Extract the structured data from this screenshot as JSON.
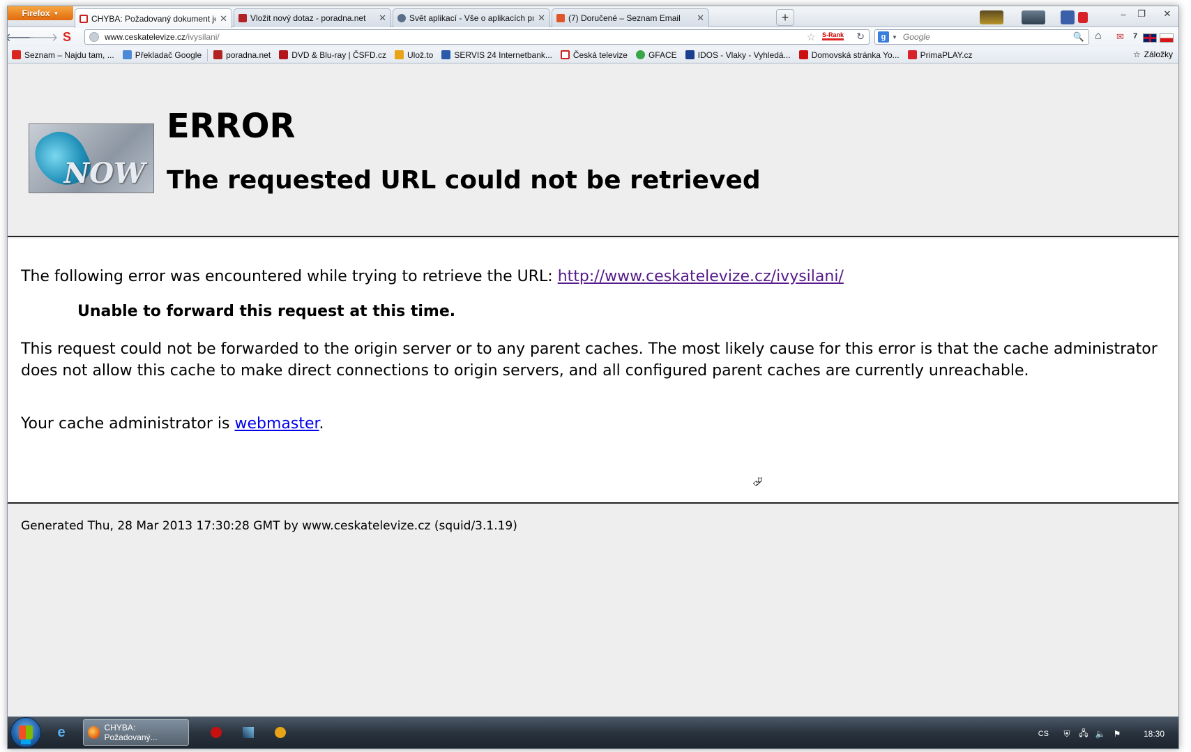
{
  "browser": {
    "menu_button": "Firefox",
    "tabs": [
      {
        "label": "CHYBA: Požadovaný dokument je ne...",
        "icon_color": "#cc1f1f",
        "active": true
      },
      {
        "label": "Vložit nový dotaz - poradna.net",
        "icon_color": "#b22222",
        "active": false
      },
      {
        "label": "Svět aplikací - Vše o aplikacích pro ch...",
        "icon_color": "#5a6f8a",
        "active": false
      },
      {
        "label": "(7) Doručené – Seznam Email",
        "icon_color": "#e0552a",
        "active": false
      }
    ],
    "url": {
      "host": "www.ceskatelevize.cz",
      "path": "/ivysilani/"
    },
    "srank_label": "S-Rank",
    "search_placeholder": "Google",
    "mail_count": "7",
    "bookmarks": [
      {
        "label": "Seznam – Najdu tam, ...",
        "icon_color": "#d9251d"
      },
      {
        "label": "Překladač Google",
        "icon_color": "#4a8ad6"
      },
      {
        "label": "poradna.net",
        "icon_color": "#b22222"
      },
      {
        "label": "DVD & Blu-ray | ČSFD.cz",
        "icon_color": "#b4151a"
      },
      {
        "label": "Ulož.to",
        "icon_color": "#e8a317"
      },
      {
        "label": "SERVIS 24 Internetbank...",
        "icon_color": "#2a5aa8"
      },
      {
        "label": "Česká televize",
        "icon_color": "#cc1f1f"
      },
      {
        "label": "GFACE",
        "icon_color": "#3aa547"
      },
      {
        "label": "IDOS - Vlaky - Vyhledá...",
        "icon_color": "#1b3f8f"
      },
      {
        "label": "Domovská stránka Yo...",
        "icon_color": "#cc1111"
      },
      {
        "label": "PrimaPLAY.cz",
        "icon_color": "#d8222a"
      }
    ],
    "bookmarks_folder": "Záložky"
  },
  "page": {
    "logo_text": "NOW",
    "title": "ERROR",
    "subtitle": "The requested URL could not be retrieved",
    "intro": "The following error was encountered while trying to retrieve the URL: ",
    "error_url": "http://www.ceskatelevize.cz/ivysilani/",
    "reason": "Unable to forward this request at this time.",
    "description": "This request could not be forwarded to the origin server or to any parent caches. The most likely cause for this error is that the cache administrator does not allow this cache to make direct connections to origin servers, and all configured parent caches are currently unreachable.",
    "admin_prefix": "Your cache administrator is ",
    "admin_link": "webmaster",
    "admin_suffix": ".",
    "footer": "Generated Thu, 28 Mar 2013 17:30:28 GMT by www.ceskatelevize.cz (squid/3.1.19)"
  },
  "taskbar": {
    "task_label": "CHYBA: Požadovaný...",
    "language": "CS",
    "clock": "18:30"
  }
}
